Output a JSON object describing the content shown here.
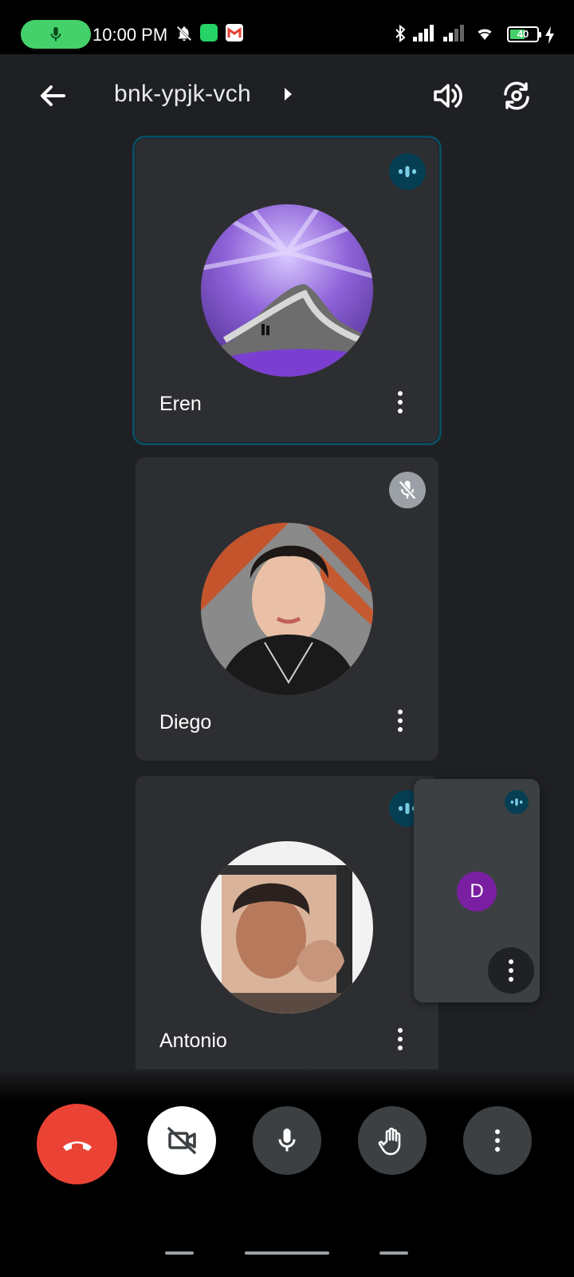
{
  "status_bar": {
    "time": "10:00 PM",
    "battery": "40",
    "icons": [
      "mic-icon",
      "mute-bell-icon",
      "whatsapp-icon",
      "gmail-icon",
      "bluetooth-icon",
      "signal-icon",
      "signal-icon",
      "wifi-icon",
      "battery-icon",
      "charging-icon"
    ]
  },
  "header": {
    "meeting_code": "bnk-ypjk-vch"
  },
  "participants": [
    {
      "name": "Eren",
      "status": "speaking"
    },
    {
      "name": "Diego",
      "status": "muted"
    },
    {
      "name": "Antonio",
      "status": "speaking"
    }
  ],
  "self_view": {
    "initial": "D"
  },
  "controls": [
    "end-call",
    "camera-off",
    "microphone",
    "raise-hand",
    "more-options"
  ],
  "colors": {
    "background": "#1f2023",
    "tile": "#2d2e31",
    "active_outline": "#0c4c60",
    "end_call": "#ea4335",
    "self_avatar": "#7b1fa2",
    "mic_pill": "#44d16b"
  }
}
